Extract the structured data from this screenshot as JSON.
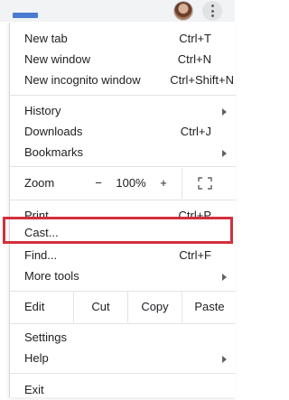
{
  "toolbar": {
    "extension_icon": "extension-badge-icon",
    "avatar_icon": "profile-avatar-icon",
    "menu_icon": "three-dots-vertical-icon"
  },
  "menu": {
    "new_tab": {
      "label": "New tab",
      "shortcut": "Ctrl+T"
    },
    "new_window": {
      "label": "New window",
      "shortcut": "Ctrl+N"
    },
    "new_incognito": {
      "label": "New incognito window",
      "shortcut": "Ctrl+Shift+N"
    },
    "history": {
      "label": "History"
    },
    "downloads": {
      "label": "Downloads",
      "shortcut": "Ctrl+J"
    },
    "bookmarks": {
      "label": "Bookmarks"
    },
    "zoom": {
      "label": "Zoom",
      "minus": "−",
      "level": "100%",
      "plus": "+",
      "fullscreen_icon": "fullscreen-icon"
    },
    "print": {
      "label": "Print...",
      "shortcut": "Ctrl+P"
    },
    "cast": {
      "label": "Cast..."
    },
    "find": {
      "label": "Find...",
      "shortcut": "Ctrl+F"
    },
    "more_tools": {
      "label": "More tools"
    },
    "edit": {
      "label": "Edit",
      "cut": "Cut",
      "copy": "Copy",
      "paste": "Paste"
    },
    "settings": {
      "label": "Settings"
    },
    "help": {
      "label": "Help"
    },
    "exit": {
      "label": "Exit"
    }
  },
  "highlight": {
    "color": "#d32f3c",
    "target": "cast"
  }
}
